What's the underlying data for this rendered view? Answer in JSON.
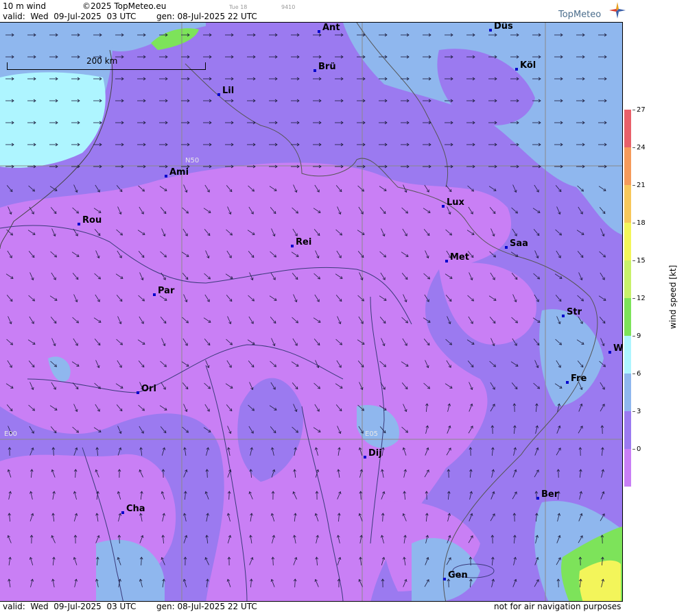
{
  "header": {
    "product": "10 m wind",
    "copyright": "©2025 TopMeteo.eu",
    "valid": "valid:  Wed  09-Jul-2025  03 UTC",
    "gen": "gen: 08-Jul-2025 22 UTC",
    "small1": "Tue 18",
    "small2": "9410",
    "brand": "TopMeteo"
  },
  "map": {
    "scale_label": "200 km",
    "grid_labels": {
      "lat": "N50",
      "lon0": "E00",
      "lon5": "E05"
    },
    "colors": {
      "calm": "#c97ff5",
      "low": "#9b7af0",
      "mid": "#8fb7ee",
      "high": "#aef5ff",
      "green": "#7de35a",
      "yellow": "#f3f55a"
    },
    "cities": [
      {
        "name": "Ant"
      },
      {
        "name": "Düs"
      },
      {
        "name": "Brü"
      },
      {
        "name": "Köl"
      },
      {
        "name": "Lil"
      },
      {
        "name": "Ami"
      },
      {
        "name": "Lux"
      },
      {
        "name": "Rou"
      },
      {
        "name": "Rei"
      },
      {
        "name": "Saa"
      },
      {
        "name": "Met"
      },
      {
        "name": "Par"
      },
      {
        "name": "Str"
      },
      {
        "name": "W"
      },
      {
        "name": "Fre"
      },
      {
        "name": "Orl"
      },
      {
        "name": "Dij"
      },
      {
        "name": "Ber"
      },
      {
        "name": "Cha"
      },
      {
        "name": "Gen"
      }
    ]
  },
  "legend": {
    "title": "wind  speed  [kt]",
    "ticks": [
      "27",
      "24",
      "21",
      "18",
      "15",
      "12",
      "9",
      "6",
      "3",
      "0"
    ],
    "colors": [
      "#e8606a",
      "#f59a5a",
      "#f7c75a",
      "#f3f55a",
      "#c8f06a",
      "#7de35a",
      "#aef5ff",
      "#8fb7ee",
      "#9b7af0",
      "#c97ff5"
    ]
  },
  "footer": {
    "valid": "valid:  Wed  09-Jul-2025  03 UTC",
    "gen": "gen: 08-Jul-2025 22 UTC",
    "notice": "not for air navigation purposes"
  }
}
